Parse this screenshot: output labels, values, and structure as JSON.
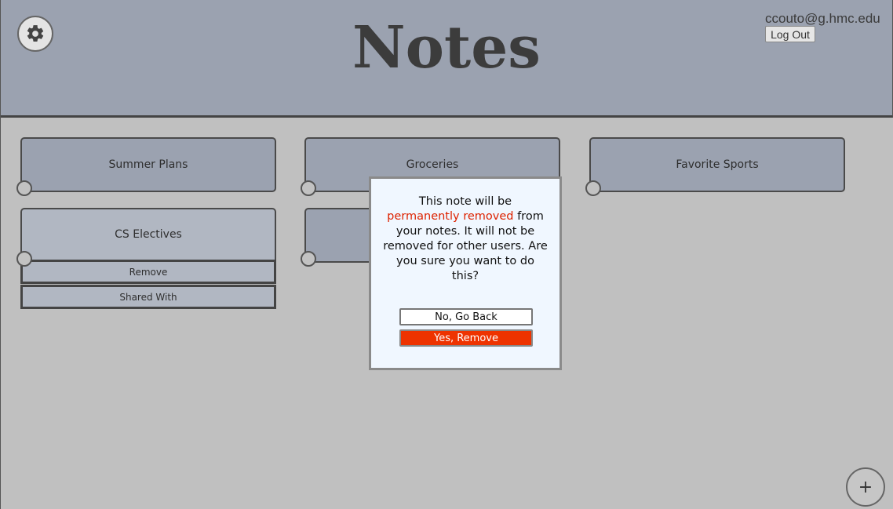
{
  "header": {
    "title": "Notes",
    "user_email": "ccouto@g.hmc.edu",
    "logout_label": "Log Out"
  },
  "notes": [
    {
      "title": "Summer Plans"
    },
    {
      "title": "Groceries"
    },
    {
      "title": "Favorite Sports"
    },
    {
      "title": "CS Electives"
    },
    {
      "title": ""
    }
  ],
  "note_menu": {
    "remove_label": "Remove",
    "shared_label": "Shared With"
  },
  "modal": {
    "message_before": "This note will be ",
    "message_highlight": "permanently removed",
    "message_after": " from your notes. It will not be removed for other users. Are you sure you want to do this?",
    "cancel_label": "No, Go Back",
    "confirm_label": "Yes, Remove"
  },
  "add_button": {
    "icon": "plus-icon",
    "glyph": "+"
  },
  "settings_button": {
    "icon": "gear-icon"
  },
  "colors": {
    "header_bg": "#9ba2b0",
    "page_bg": "#c0c0c0",
    "card_bg": "#9ba2b0",
    "card_expanded_bg": "#b1b7c2",
    "modal_bg": "#f0f7ff",
    "danger": "#ee3300"
  }
}
